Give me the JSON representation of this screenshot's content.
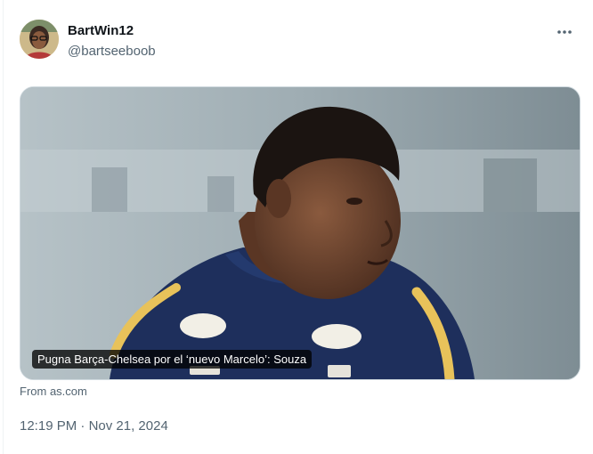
{
  "author": {
    "name": "BartWin12",
    "handle": "@bartseeboob"
  },
  "more_icon": "more-horizontal-icon",
  "card": {
    "caption": "Pugna Barça-Chelsea por el ‘nuevo Marcelo’: Souza",
    "source": "From as.com"
  },
  "timestamp": {
    "time": "12:19 PM",
    "separator": "·",
    "date": "Nov 21, 2024"
  },
  "colors": {
    "text_primary": "#0f1419",
    "text_secondary": "#536471",
    "border": "#cfd9de",
    "jersey": "#1e2f5c",
    "sponsor_gold": "#e8c25a"
  }
}
